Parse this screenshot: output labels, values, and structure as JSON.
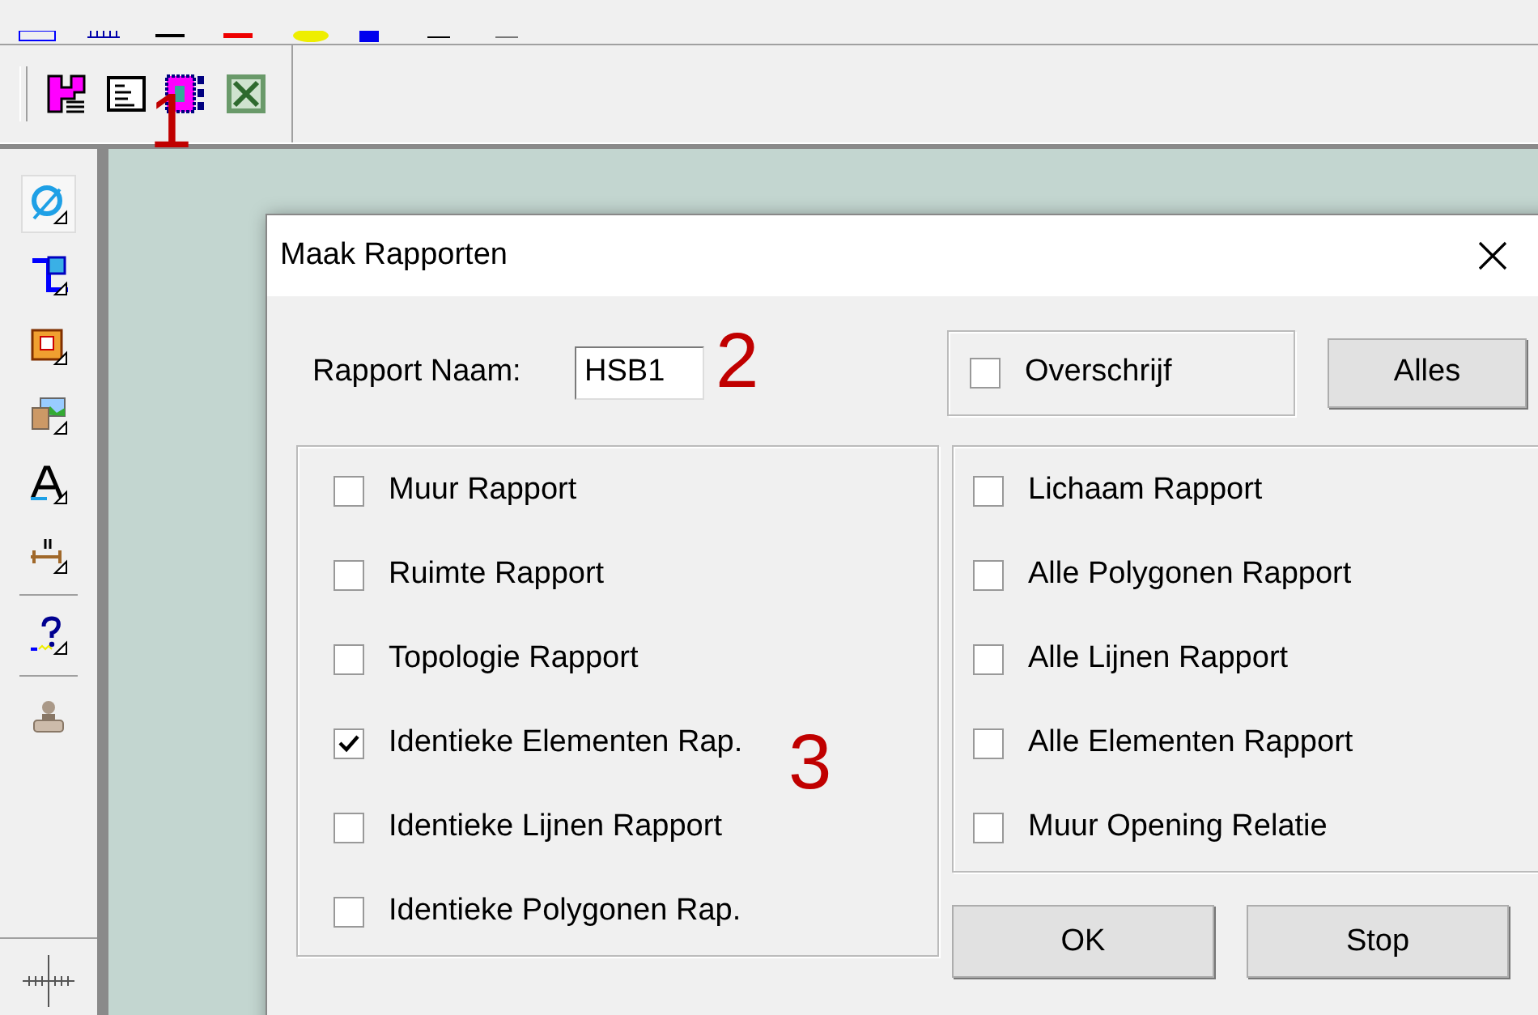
{
  "toolbar": {
    "kind": "horizontal"
  },
  "dialog": {
    "title": "Maak Rapporten",
    "name_label": "Rapport Naam:",
    "name_value": "HSB1",
    "overwrite": {
      "label": "Overschrijf",
      "checked": false
    },
    "all_button": "Alles",
    "left_options": [
      {
        "label": "Muur Rapport",
        "checked": false
      },
      {
        "label": "Ruimte Rapport",
        "checked": false
      },
      {
        "label": "Topologie Rapport",
        "checked": false
      },
      {
        "label": "Identieke Elementen Rap.",
        "checked": true
      },
      {
        "label": "Identieke Lijnen Rapport",
        "checked": false
      },
      {
        "label": "Identieke Polygonen Rap.",
        "checked": false
      }
    ],
    "right_options": [
      {
        "label": "Lichaam Rapport",
        "checked": false
      },
      {
        "label": "Alle Polygonen Rapport",
        "checked": false
      },
      {
        "label": "Alle Lijnen Rapport",
        "checked": false
      },
      {
        "label": "Alle Elementen Rapport",
        "checked": false
      },
      {
        "label": "Muur Opening Relatie",
        "checked": false
      }
    ],
    "buttons": [
      {
        "label": "OK"
      },
      {
        "label": "Stop"
      }
    ]
  },
  "annotations": [
    {
      "label": "1"
    },
    {
      "label": "2"
    },
    {
      "label": "3"
    }
  ]
}
